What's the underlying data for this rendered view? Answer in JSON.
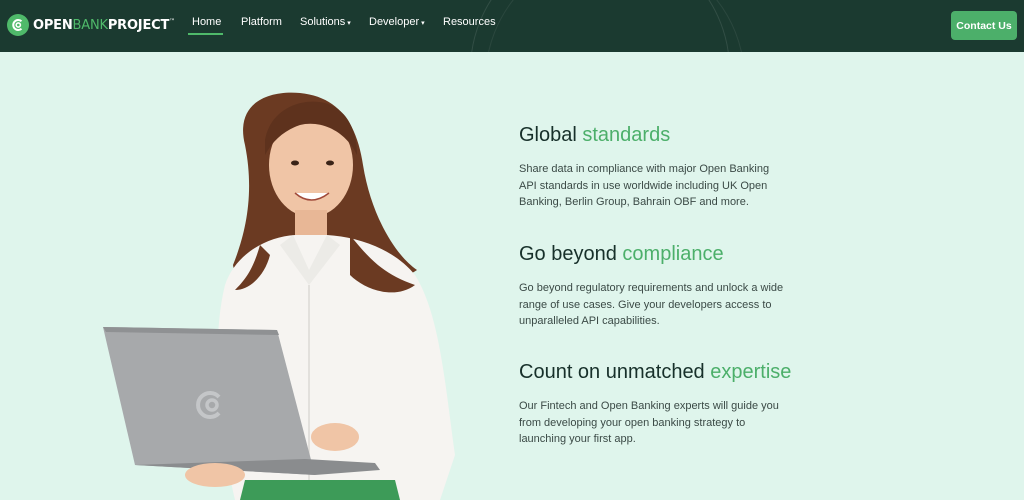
{
  "brand": {
    "name_part1": "OPEN",
    "name_part2": "BANK",
    "name_part3": "PROJECT",
    "trademark": "™"
  },
  "nav": {
    "items": [
      {
        "label": "Home",
        "active": true,
        "dropdown": false
      },
      {
        "label": "Platform",
        "active": false,
        "dropdown": false
      },
      {
        "label": "Solutions",
        "active": false,
        "dropdown": true
      },
      {
        "label": "Developer",
        "active": false,
        "dropdown": true
      },
      {
        "label": "Resources",
        "active": false,
        "dropdown": false
      }
    ],
    "contact_label": "Contact Us"
  },
  "features": [
    {
      "title_plain": "Global ",
      "title_highlight": "standards",
      "description": "Share data in compliance with major Open Banking API standards in use worldwide including UK Open Banking, Berlin Group, Bahrain OBF and more."
    },
    {
      "title_plain": "Go beyond ",
      "title_highlight": "compliance",
      "description": "Go beyond regulatory requirements and unlock a wide range of use cases. Give your developers access to unparalleled API capabilities."
    },
    {
      "title_plain": "Count on unmatched ",
      "title_highlight": "expertise",
      "description": "Our Fintech and Open Banking experts will guide you from developing your open banking strategy to launching your first app."
    }
  ],
  "colors": {
    "nav_bg": "#1b3a30",
    "page_bg": "#dff5ec",
    "accent": "#4caf6a",
    "heading": "#17302a",
    "body_text": "#3b4a46"
  },
  "icons": {
    "logo": "openbank-logo-icon",
    "dropdown": "caret-down-icon"
  }
}
